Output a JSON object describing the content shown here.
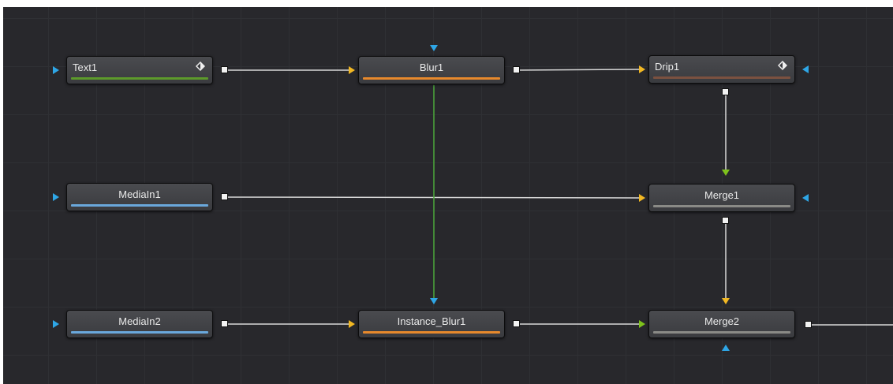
{
  "colors": {
    "canvas": "#28282c",
    "wire": "#d8d8d8",
    "instance_wire": "#4aa83a",
    "input_main": "#f2b823",
    "input_effect": "#7ec21c",
    "input_mask": "#2ea6e6"
  },
  "nodes": {
    "text1": {
      "label": "Text1",
      "bar": "#5d9a2b",
      "icon": "keyframe-diamond-icon"
    },
    "blur1": {
      "label": "Blur1",
      "bar": "#e7892c"
    },
    "drip1": {
      "label": "Drip1",
      "bar": "#7b5140",
      "icon": "keyframe-diamond-icon"
    },
    "mediain1": {
      "label": "MediaIn1",
      "bar": "#6aa8dc"
    },
    "merge1": {
      "label": "Merge1",
      "bar": "#8a8a86"
    },
    "mediain2": {
      "label": "MediaIn2",
      "bar": "#6aa8dc"
    },
    "instance_blur1": {
      "label": "Instance_Blur1",
      "bar": "#e7892c"
    },
    "merge2": {
      "label": "Merge2",
      "bar": "#8a8a86"
    }
  }
}
